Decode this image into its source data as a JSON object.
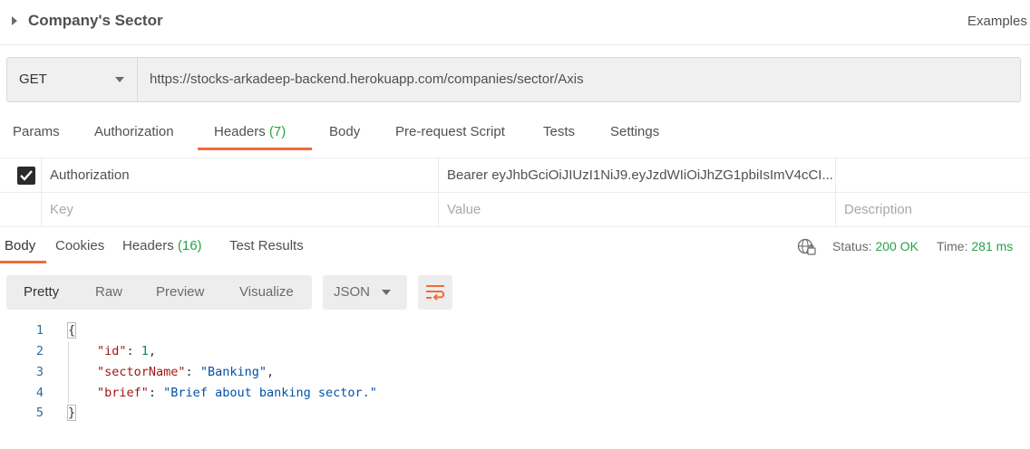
{
  "request": {
    "title": "Company's Sector",
    "examples_label": "Examples",
    "method": "GET",
    "url": "https://stocks-arkadeep-backend.herokuapp.com/companies/sector/Axis"
  },
  "request_tabs": [
    {
      "label": "Params",
      "count": ""
    },
    {
      "label": "Authorization",
      "count": ""
    },
    {
      "label": "Headers",
      "count": "(7)"
    },
    {
      "label": "Body",
      "count": ""
    },
    {
      "label": "Pre-request Script",
      "count": ""
    },
    {
      "label": "Tests",
      "count": ""
    },
    {
      "label": "Settings",
      "count": ""
    }
  ],
  "active_request_tab": "Headers",
  "headers_table": {
    "rows": [
      {
        "checked": true,
        "key": "Authorization",
        "value": "Bearer eyJhbGciOiJIUzI1NiJ9.eyJzdWIiOiJhZG1pbiIsImV4cCI6...",
        "description": ""
      }
    ],
    "placeholder": {
      "key": "Key",
      "value": "Value",
      "description": "Description"
    }
  },
  "response_tabs": [
    {
      "label": "Body",
      "count": ""
    },
    {
      "label": "Cookies",
      "count": ""
    },
    {
      "label": "Headers",
      "count": "(16)"
    },
    {
      "label": "Test Results",
      "count": ""
    }
  ],
  "active_response_tab": "Body",
  "status": {
    "status_label": "Status:",
    "status_value": "200 OK",
    "time_label": "Time:",
    "time_value": "281 ms"
  },
  "view_modes": [
    "Pretty",
    "Raw",
    "Preview",
    "Visualize"
  ],
  "active_view_mode": "Pretty",
  "format": "JSON",
  "code": {
    "line_numbers": [
      "1",
      "2",
      "3",
      "4",
      "5"
    ],
    "open_brace": "{",
    "close_brace": "}",
    "fields": [
      {
        "key": "\"id\"",
        "value": "1",
        "type": "number",
        "comma": ","
      },
      {
        "key": "\"sectorName\"",
        "value": "\"Banking\"",
        "type": "string",
        "comma": ","
      },
      {
        "key": "\"brief\"",
        "value": "\"Brief about banking sector.\"",
        "type": "string",
        "comma": ""
      }
    ]
  },
  "colors": {
    "accent": "#f26b3a",
    "success": "#26a248",
    "json_key": "#a31515",
    "json_string": "#0451a5",
    "json_number": "#098658"
  }
}
